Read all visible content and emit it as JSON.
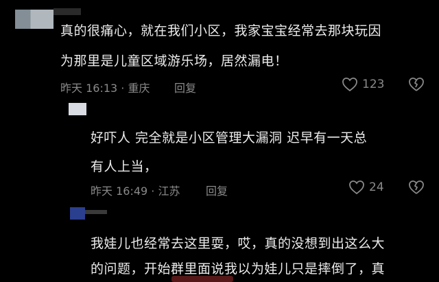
{
  "comments": [
    {
      "lines": [
        "真的很痛心，就在我们小区，我家宝宝经常去那块玩因",
        "为那里是儿童区域游乐场，居然漏电！"
      ],
      "meta": "昨天 16:13 · 重庆",
      "reply_label": "回复",
      "like_count": "123"
    },
    {
      "lines": [
        "好吓人  完全就是小区管理大漏洞  迟早有一天总",
        "有人上当，"
      ],
      "meta": "昨天 16:49 · 江苏",
      "reply_label": "回复",
      "like_count": "24"
    },
    {
      "lines": [
        "我娃儿也经常去这里耍，哎，真的没想到出这么大",
        "的问题，开始群里面说我以为娃儿只是摔倒了，真"
      ]
    }
  ],
  "colors": {
    "background": "#000000",
    "text": "#ececec",
    "meta": "#8a8a8a"
  }
}
